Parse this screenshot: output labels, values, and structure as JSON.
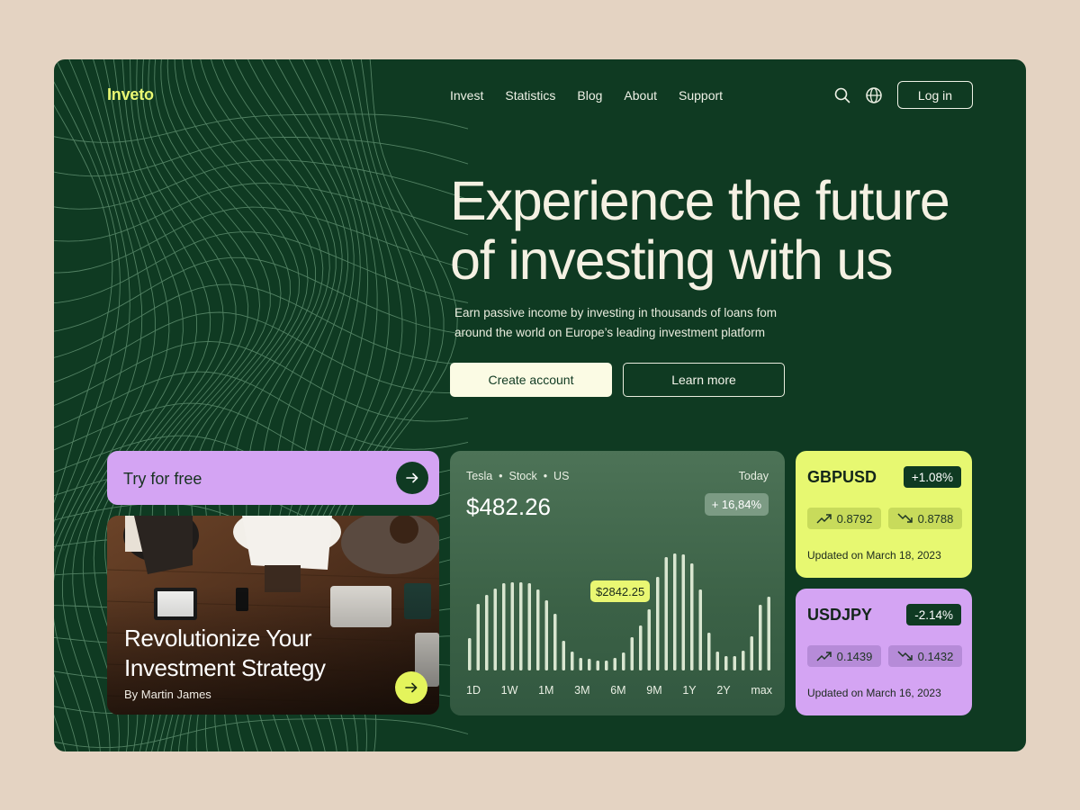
{
  "brand": {
    "name": "Inveto",
    "accent": "#e9f772",
    "background": "#0f3a22"
  },
  "nav": {
    "items": [
      "Invest",
      "Statistics",
      "Blog",
      "About",
      "Support"
    ],
    "search_icon": "search-icon",
    "language_icon": "globe-icon",
    "login_label": "Log in"
  },
  "hero": {
    "headline_line1": "Experience the future",
    "headline_line2": "of investing with us",
    "subtitle_line1": "Earn passive income by investing in thousands of loans fom",
    "subtitle_line2": "around the world on Europe’s leading investment platform",
    "primary_cta": "Create account",
    "secondary_cta": "Learn more"
  },
  "try_card": {
    "label": "Try for free",
    "color": "#d4a4f3"
  },
  "article_card": {
    "title_line1": "Revolutionize Your",
    "title_line2": "Investment Strategy",
    "author": "By Martin James"
  },
  "stock_card": {
    "company": "Tesla",
    "asset_type": "Stock",
    "market": "US",
    "period": "Today",
    "price": "$482.26",
    "change": "+ 16,84%",
    "tooltip": "$2842.25",
    "ranges": [
      "1D",
      "1W",
      "1M",
      "3M",
      "6M",
      "9M",
      "1Y",
      "2Y",
      "max"
    ]
  },
  "fx_cards": [
    {
      "pair": "GBPUSD",
      "change": "+1.08%",
      "up_value": "0.8792",
      "down_value": "0.8788",
      "updated": "Updated on March 18, 2023",
      "color": "#e7f871"
    },
    {
      "pair": "USDJPY",
      "change": "-2.14%",
      "up_value": "0.1439",
      "down_value": "0.1432",
      "updated": "Updated on March 16, 2023",
      "color": "#d4a4f3"
    }
  ]
}
